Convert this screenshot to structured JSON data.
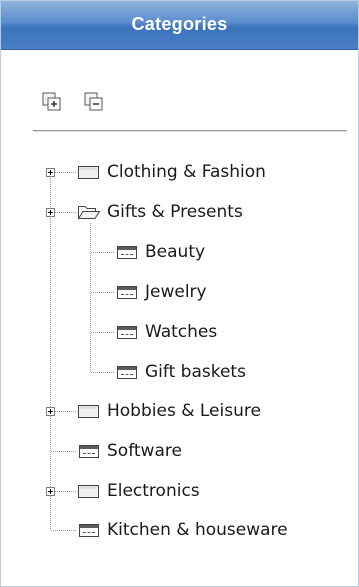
{
  "header": {
    "title": "Categories"
  },
  "toolbar": {
    "expand_all_icon": "expand-all-icon",
    "collapse_all_icon": "collapse-all-icon"
  },
  "tree": {
    "items": [
      {
        "label": "Clothing & Fashion",
        "type": "folder",
        "expanded": false,
        "has_children": true
      },
      {
        "label": "Gifts & Presents",
        "type": "folder-open",
        "expanded": true,
        "has_children": true
      },
      {
        "label": "Beauty",
        "type": "leaf",
        "depth": 1
      },
      {
        "label": "Jewelry",
        "type": "leaf",
        "depth": 1
      },
      {
        "label": "Watches",
        "type": "leaf",
        "depth": 1
      },
      {
        "label": "Gift baskets",
        "type": "leaf",
        "depth": 1
      },
      {
        "label": "Hobbies & Leisure",
        "type": "folder",
        "expanded": false,
        "has_children": true
      },
      {
        "label": "Software",
        "type": "leaf"
      },
      {
        "label": "Electronics",
        "type": "folder",
        "expanded": false,
        "has_children": true
      },
      {
        "label": "Kitchen & houseware",
        "type": "leaf"
      }
    ]
  },
  "colors": {
    "header_top": "#8fb3dc",
    "header_bottom": "#3d73bd",
    "tree_line": "#9a9a9a",
    "text": "#1a1a1a"
  }
}
